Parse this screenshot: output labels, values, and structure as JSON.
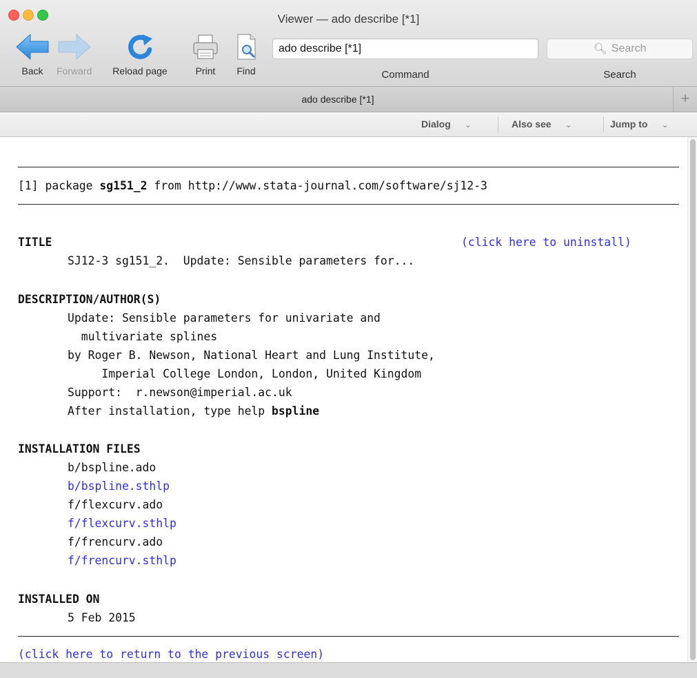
{
  "window": {
    "title": "Viewer — ado describe [*1]"
  },
  "toolbar": {
    "back": "Back",
    "forward": "Forward",
    "reload": "Reload page",
    "print": "Print",
    "find": "Find",
    "command_value": "ado describe [*1]",
    "command_label": "Command",
    "search_placeholder": "Search",
    "search_label": "Search"
  },
  "tab": {
    "label": "ado describe [*1]",
    "add": "+"
  },
  "menubar": {
    "dialog": "Dialog",
    "also_see": "Also see",
    "jump_to": "Jump to"
  },
  "content": {
    "package_line": {
      "prefix": "[1] package ",
      "name": "sg151_2",
      "suffix": " from http://www.stata-journal.com/software/sj12-3"
    },
    "title_heading": "TITLE",
    "uninstall_link": "(click here to uninstall)",
    "title_text": "SJ12-3 sg151_2.  Update: Sensible parameters for...",
    "desc_heading": "DESCRIPTION/AUTHOR(S)",
    "desc_lines": [
      "Update: Sensible parameters for univariate and",
      "  multivariate splines",
      "by Roger B. Newson, National Heart and Lung Institute,",
      "     Imperial College London, London, United Kingdom",
      "Support:  r.newson@imperial.ac.uk"
    ],
    "after_install_prefix": "After installation, type help ",
    "after_install_cmd": "bspline",
    "files_heading": "INSTALLATION FILES",
    "files": [
      "b/bspline.ado",
      "b/bspline.sthlp",
      "f/flexcurv.ado",
      "f/flexcurv.sthlp",
      "f/frencurv.ado",
      "f/frencurv.sthlp"
    ],
    "installed_heading": "INSTALLED ON",
    "installed_date": "5 Feb 2015",
    "return_link": "(click here to return to the previous screen)"
  }
}
